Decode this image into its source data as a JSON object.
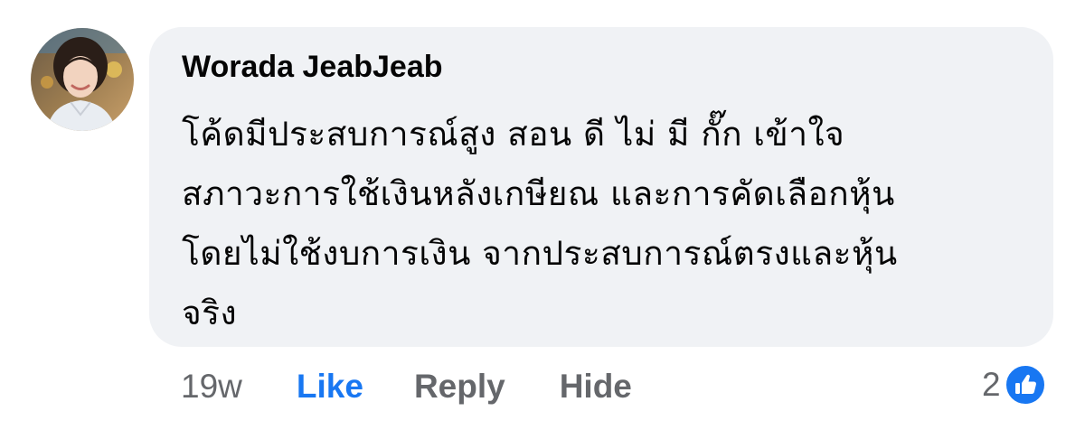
{
  "comment": {
    "author": "Worada JeabJeab",
    "avatar_icon": "profile-photo",
    "text_lines": [
      "โค้ดมีประสบการณ์สูง สอน ดี ไม่ มี กั๊ก เข้าใจ",
      "สภาวะการใช้เงินหลังเกษียณ และการคัดเลือกหุ้น",
      "โดยไม่ใช้งบการเงิน จากประสบการณ์ตรงและหุ้น",
      "จริง"
    ],
    "time": "19w",
    "actions": {
      "like": "Like",
      "reply": "Reply",
      "hide": "Hide"
    },
    "reactions": {
      "count": "2",
      "icon": "thumbs-up-icon",
      "color": "#1877f2"
    }
  },
  "colors": {
    "bubble": "#f0f2f5",
    "text": "#050505",
    "muted": "#65676b",
    "accent": "#1877f2"
  }
}
